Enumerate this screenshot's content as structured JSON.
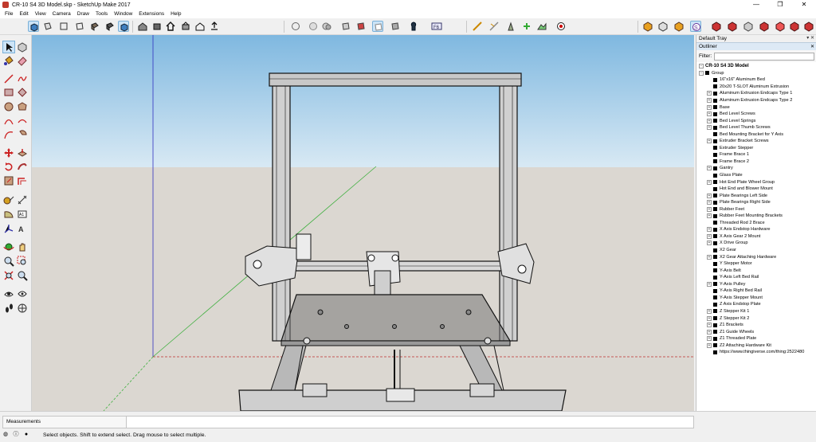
{
  "window": {
    "title": "CR-10 S4 3D Model.skp - SketchUp Make 2017",
    "controls": [
      "—",
      "❐",
      "✕"
    ]
  },
  "menu": [
    "File",
    "Edit",
    "View",
    "Camera",
    "Draw",
    "Tools",
    "Window",
    "Extensions",
    "Help"
  ],
  "tray": {
    "title": "Default Tray",
    "close_glyph": "▾ ✕",
    "panel": "Outliner",
    "panel_glyph": "✕",
    "filter_label": "Filter:",
    "filter_value": "",
    "model_name": "CR-10 S4 3D Model",
    "group_label": "Group",
    "items": [
      {
        "label": "16\"x16\" Aluminum Bed",
        "expandable": false
      },
      {
        "label": "20x20 T-SLOT Aluminum Extrusion",
        "expandable": false
      },
      {
        "label": "Aluminum Extrusion Endcaps Type 1",
        "expandable": true
      },
      {
        "label": "Aluminum Extrusion Endcaps Type 2",
        "expandable": true
      },
      {
        "label": "Base",
        "expandable": true
      },
      {
        "label": "Bed Level Screws",
        "expandable": true
      },
      {
        "label": "Bed Level Springs",
        "expandable": true
      },
      {
        "label": "Bed Level Thumb Screws",
        "expandable": true
      },
      {
        "label": "Bed Mounting Bracket for Y Axis",
        "expandable": false
      },
      {
        "label": "Extruder Bracket Screws",
        "expandable": true
      },
      {
        "label": "Extruder Stepper",
        "expandable": false
      },
      {
        "label": "Frame Brace 1",
        "expandable": false
      },
      {
        "label": "Frame Brace 2",
        "expandable": false
      },
      {
        "label": "Gantry",
        "expandable": true
      },
      {
        "label": "Glass Plate",
        "expandable": false
      },
      {
        "label": "Hot End Plate Wheel Group",
        "expandable": true
      },
      {
        "label": "Hot End and Blower Mount",
        "expandable": false
      },
      {
        "label": "Plate Bearings Left Side",
        "expandable": true
      },
      {
        "label": "Plate Bearings Right Side",
        "expandable": true
      },
      {
        "label": "Rubber Feet",
        "expandable": true
      },
      {
        "label": "Rubber Feet Mounting Brackets",
        "expandable": true
      },
      {
        "label": "Threaded Rod 2 Brace",
        "expandable": false
      },
      {
        "label": "X Axis Endstop Hardware",
        "expandable": true
      },
      {
        "label": "X Axis Gear 2 Mount",
        "expandable": true
      },
      {
        "label": "X Drive Group",
        "expandable": true
      },
      {
        "label": "X2 Gear",
        "expandable": false
      },
      {
        "label": "X2 Gear Attaching Hardware",
        "expandable": true
      },
      {
        "label": "Y Stepper Motor",
        "expandable": false
      },
      {
        "label": "Y-Axis Belt",
        "expandable": false
      },
      {
        "label": "Y-Axis Left Bed Rail",
        "expandable": false
      },
      {
        "label": "Y-Axis Pulley",
        "expandable": true
      },
      {
        "label": "Y-Axis Right Bed Rail",
        "expandable": false
      },
      {
        "label": "Y-Axis Stepper Mount",
        "expandable": false
      },
      {
        "label": "Z Axis Endstop Plate",
        "expandable": false
      },
      {
        "label": "Z Stepper Kit 1",
        "expandable": true
      },
      {
        "label": "Z Stepper Kit 2",
        "expandable": true
      },
      {
        "label": "Z1 Brackets",
        "expandable": true
      },
      {
        "label": "Z1 Guide Wheels",
        "expandable": true
      },
      {
        "label": "Z1 Threaded Plate",
        "expandable": true
      },
      {
        "label": "Z2 Attaching Hardware Kit",
        "expandable": true
      },
      {
        "label": "https://www.thingiverse.com/thing:2522480",
        "expandable": false
      }
    ]
  },
  "status": {
    "measurements_label": "Measurements",
    "measurements_value": "",
    "hint": "Select objects. Shift to extend select. Drag mouse to select multiple."
  },
  "colors": {
    "sky": "#a9cfe8",
    "ground": "#d9d5cf",
    "accent": "#cce4f7"
  }
}
